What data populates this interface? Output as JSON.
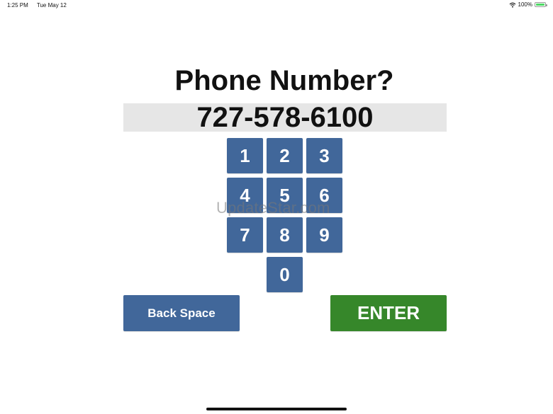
{
  "status_bar": {
    "time": "1:25 PM",
    "date": "Tue May 12",
    "battery": "100%",
    "wifi_icon": "wifi-icon",
    "battery_icon": "battery-icon",
    "battery_color": "#4cd964"
  },
  "prompt": {
    "title": "Phone Number?"
  },
  "phone_display": {
    "value": "727-578-6100"
  },
  "keypad": {
    "keys": [
      "1",
      "2",
      "3",
      "4",
      "5",
      "6",
      "7",
      "8",
      "9",
      "0"
    ],
    "key_color": "#41679a"
  },
  "actions": {
    "backspace_label": "Back Space",
    "enter_label": "ENTER",
    "backspace_color": "#41679a",
    "enter_color": "#36872a"
  },
  "watermark": {
    "text": "UpdateStar.com"
  }
}
